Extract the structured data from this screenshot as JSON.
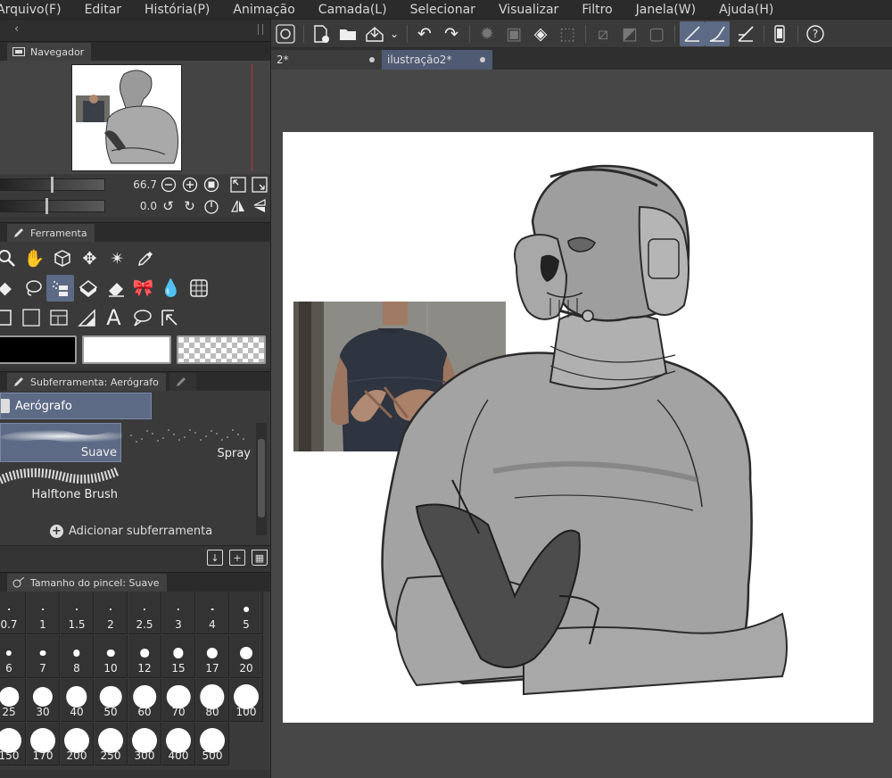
{
  "menu": [
    "Arquivo(F)",
    "Editar",
    "História(P)",
    "Animação",
    "Camada(L)",
    "Selecionar",
    "Visualizar",
    "Filtro",
    "Janela(W)",
    "Ajuda(H)"
  ],
  "navigator": {
    "tab_label": "Navegador",
    "zoom_value": "66.7",
    "rotation_value": "0.0"
  },
  "tool_palette": {
    "tab_label": "Ferramenta"
  },
  "subtool": {
    "tab_label": "Subferramenta: Aerógrafo",
    "group_label": "Aerógrafo",
    "brushes": [
      "Suave",
      "Spray",
      "Halftone Brush"
    ],
    "add_label": "Adicionar subferramenta"
  },
  "brush_size": {
    "tab_label": "Tamanho do pincel: Suave",
    "values": [
      "0.7",
      "1",
      "1.5",
      "2",
      "2.5",
      "3",
      "4",
      "5",
      "6",
      "7",
      "8",
      "10",
      "12",
      "15",
      "17",
      "20",
      "25",
      "30",
      "40",
      "50",
      "60",
      "70",
      "80",
      "100",
      "150",
      "170",
      "200",
      "250",
      "300",
      "400",
      "500"
    ]
  },
  "document_tabs": [
    {
      "label": "2*"
    },
    {
      "label": "ilustração2*"
    }
  ],
  "colors": {
    "accent": "#5d6a85",
    "main_color": "#000000",
    "sub_color": "#ffffff"
  }
}
